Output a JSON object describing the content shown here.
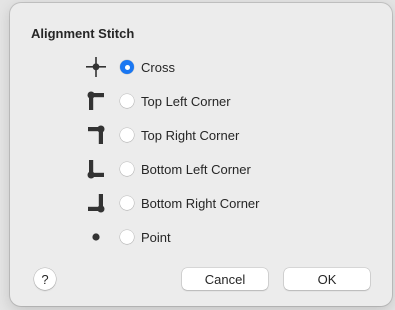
{
  "dialog": {
    "title": "Alignment Stitch",
    "options": [
      {
        "label": "Cross",
        "icon": "cross-stitch-icon",
        "selected": true
      },
      {
        "label": "Top Left Corner",
        "icon": "top-left-corner-icon",
        "selected": false
      },
      {
        "label": "Top Right Corner",
        "icon": "top-right-corner-icon",
        "selected": false
      },
      {
        "label": "Bottom Left Corner",
        "icon": "bottom-left-corner-icon",
        "selected": false
      },
      {
        "label": "Bottom Right Corner",
        "icon": "bottom-right-corner-icon",
        "selected": false
      },
      {
        "label": "Point",
        "icon": "point-icon",
        "selected": false
      }
    ],
    "help_label": "?",
    "cancel_label": "Cancel",
    "ok_label": "OK"
  },
  "colors": {
    "accent": "#1a77f2",
    "icon": "#333333",
    "dialog_background": "#ececec"
  }
}
